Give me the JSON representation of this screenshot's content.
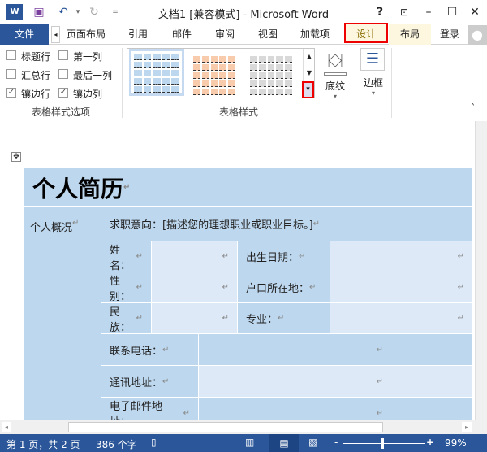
{
  "window": {
    "title": "文档1 [兼容模式] - Microsoft Word",
    "help": "?",
    "icons": [
      "word-logo",
      "save",
      "undo",
      "redo",
      "customize",
      "help",
      "ribbon-display",
      "minimize",
      "maximize",
      "close"
    ]
  },
  "tabs": {
    "file": "文件",
    "items": [
      "页面布局",
      "引用",
      "邮件",
      "审阅",
      "视图",
      "加载项",
      "设计",
      "布局"
    ],
    "active": "设计",
    "login": "登录"
  },
  "ribbon": {
    "options": [
      {
        "label": "标题行",
        "checked": false
      },
      {
        "label": "第一列",
        "checked": false
      },
      {
        "label": "汇总行",
        "checked": false
      },
      {
        "label": "最后一列",
        "checked": false
      },
      {
        "label": "镶边行",
        "checked": true
      },
      {
        "label": "镶边列",
        "checked": true
      }
    ],
    "options_group": "表格样式选项",
    "styles_group": "表格样式",
    "style_colors": [
      "#bdd7ee",
      "#f8cbad",
      "#d9d9d9"
    ],
    "shading": "底纹",
    "borders": "边框"
  },
  "document": {
    "title": "个人简历",
    "section": "个人概况",
    "objective": "求职意向：[描述您的理想职业或职业目标。]",
    "rows": [
      [
        "姓名：",
        "出生日期："
      ],
      [
        "性别：",
        "户口所在地："
      ],
      [
        "民族：",
        "专业："
      ]
    ],
    "contact": [
      "联系电话：",
      "通讯地址：",
      "电子邮件地址："
    ],
    "pilcrow": "↵"
  },
  "status": {
    "page": "第 1 页，共 2 页",
    "words": "386 个字",
    "zoom": "99%",
    "zoom_minus": "-",
    "zoom_plus": "+"
  }
}
